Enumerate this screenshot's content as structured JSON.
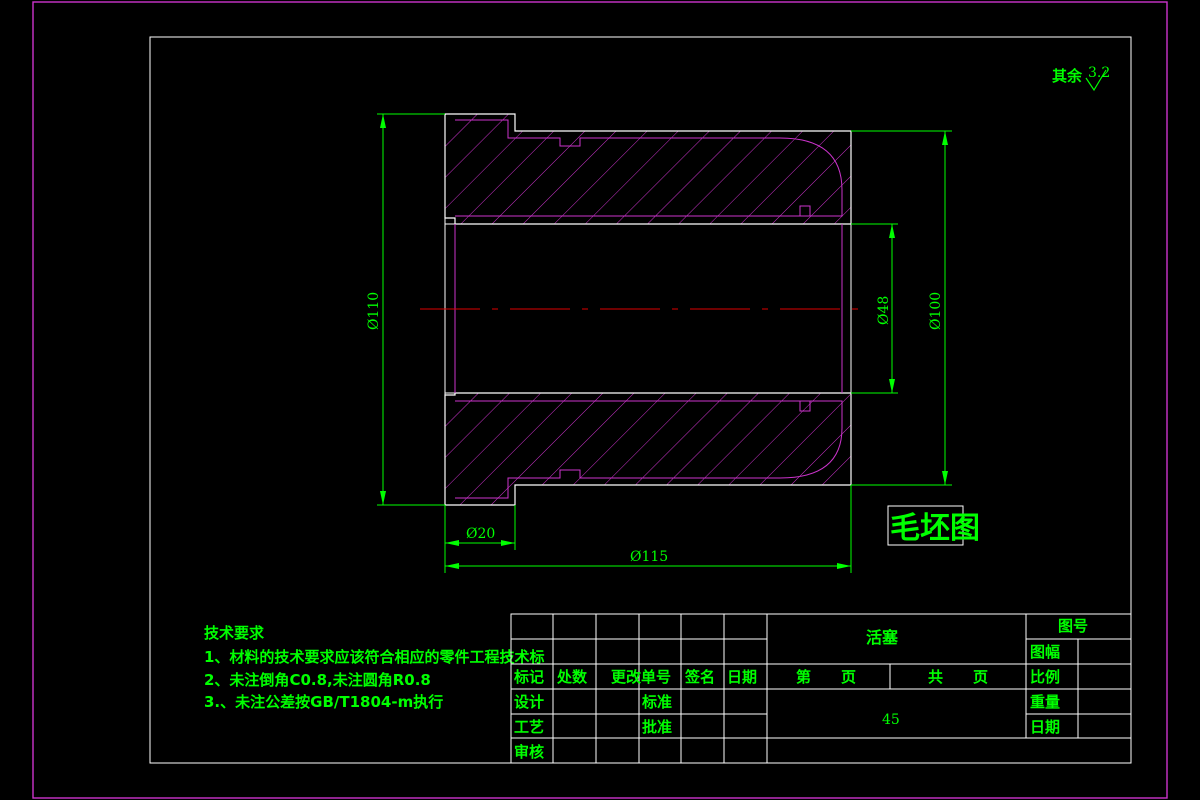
{
  "roughness": {
    "prefix": "其余",
    "value": "3.2"
  },
  "dimensions": {
    "d110": "Ø110",
    "d100": "Ø100",
    "d48": "Ø48",
    "d20": "Ø20",
    "d115": "Ø115"
  },
  "drawing_label": "毛坯图",
  "tech_requirements": {
    "heading": "技术要求",
    "items": [
      "1、材料的技术要求应该符合相应的零件工程技术标",
      "2、未注倒角C0.8,未注圆角R0.8",
      "3.、未注公差按GB/T1804-m执行"
    ]
  },
  "title_block": {
    "part_name": "活塞",
    "drawing_no_label": "图号",
    "format_label": "图幅",
    "scale_label": "比例",
    "weight_label": "重量",
    "date_label_right": "日期",
    "sheet_no": "第　　页",
    "sheet_total": "共　　页",
    "material": "45",
    "rev_headers": [
      "标记",
      "处数",
      "更改单号",
      "签名",
      "日期"
    ],
    "design": "设计",
    "process": "工艺",
    "review": "审核",
    "standard": "标准",
    "approve": "批准"
  },
  "colors": {
    "background": "#000000",
    "text": "#00ff00",
    "frame": "#cc33cc",
    "outline": "#ffffff",
    "centerline": "#dd0000"
  }
}
